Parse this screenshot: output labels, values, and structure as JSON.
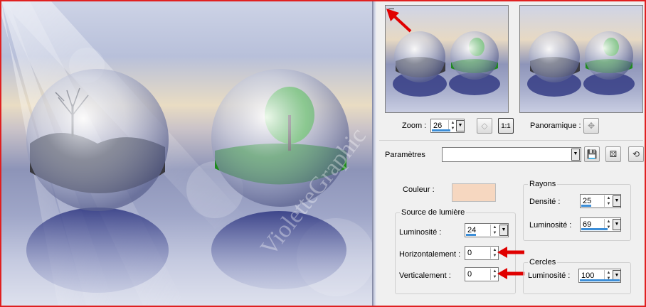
{
  "preview": {
    "watermark": "VioletteGraphic"
  },
  "zoom": {
    "label": "Zoom :",
    "value": "26",
    "ratio_label": "1:1"
  },
  "pan": {
    "label": "Panoramique :"
  },
  "params": {
    "label": "Paramètres",
    "value": ""
  },
  "color": {
    "label": "Couleur :",
    "swatch": "#f6d7c0"
  },
  "rays": {
    "title": "Rayons",
    "density_label": "Densité :",
    "density_value": "25",
    "density_level": 0.25,
    "lum_label": "Luminosité :",
    "lum_value": "69",
    "lum_level": 0.69
  },
  "light_source": {
    "title": "Source de lumière",
    "lum_label": "Luminosité :",
    "lum_value": "24",
    "lum_level": 0.24,
    "horiz_label": "Horizontalement :",
    "horiz_value": "0",
    "vert_label": "Verticalement :",
    "vert_value": "0"
  },
  "circles": {
    "title": "Cercles",
    "lum_label": "Luminosité :",
    "lum_value": "100",
    "lum_level": 1.0
  },
  "colors": {
    "accent": "#3c8ed8",
    "frame": "#e02020"
  }
}
